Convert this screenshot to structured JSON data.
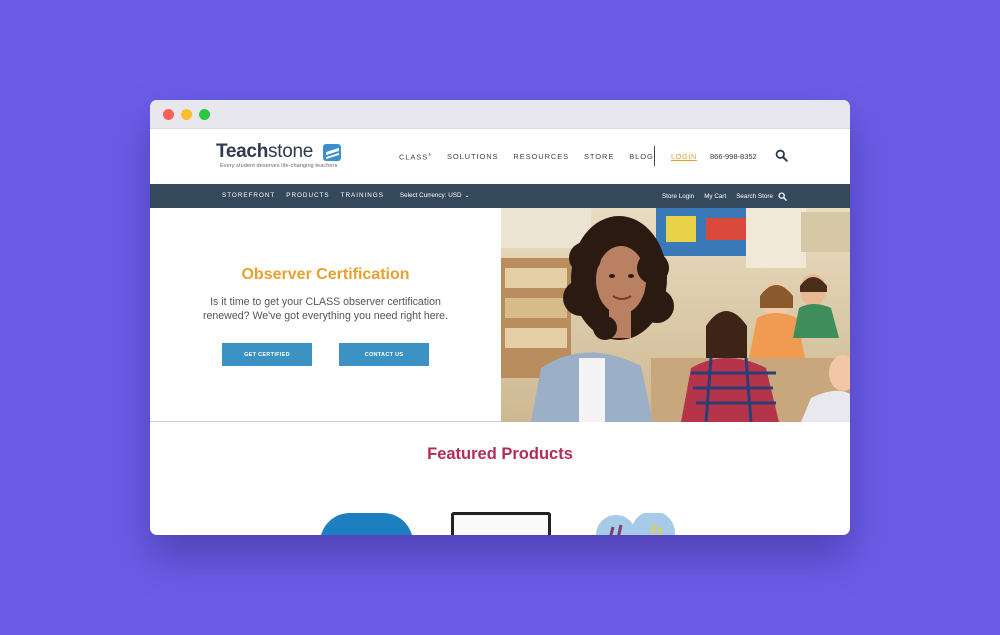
{
  "window": {
    "controls": [
      "close",
      "minimize",
      "maximize"
    ]
  },
  "header": {
    "logo": {
      "brand_bold": "Teach",
      "brand_light": "stone",
      "tagline": "Every student deserves life-changing teachers"
    },
    "nav": [
      {
        "label": "CLASS",
        "sup": "®"
      },
      {
        "label": "SOLUTIONS",
        "sup": ""
      },
      {
        "label": "RESOURCES",
        "sup": ""
      },
      {
        "label": "STORE",
        "sup": ""
      },
      {
        "label": "BLOG",
        "sup": ""
      }
    ],
    "login": "LOGIN",
    "phone": "866-998-8352",
    "search_icon": "search-icon"
  },
  "store_bar": {
    "links": [
      "STOREFRONT",
      "PRODUCTS",
      "TRAININGS"
    ],
    "currency": "Select Currency: USD",
    "right_links": [
      "Store Login",
      "My Cart",
      "Search Store"
    ]
  },
  "hero": {
    "title": "Observer Certification",
    "subtitle": "Is it time to get your CLASS observer certification renewed? We've got everything you need right here.",
    "buttons": [
      "GET CERTIFIED",
      "CONTACT US"
    ]
  },
  "featured": {
    "title": "Featured Products"
  },
  "colors": {
    "background": "#6b5ce7",
    "store_bar": "#34495c",
    "accent_orange": "#e6a12e",
    "button_blue": "#3c93c3",
    "featured_title": "#b42c53"
  }
}
